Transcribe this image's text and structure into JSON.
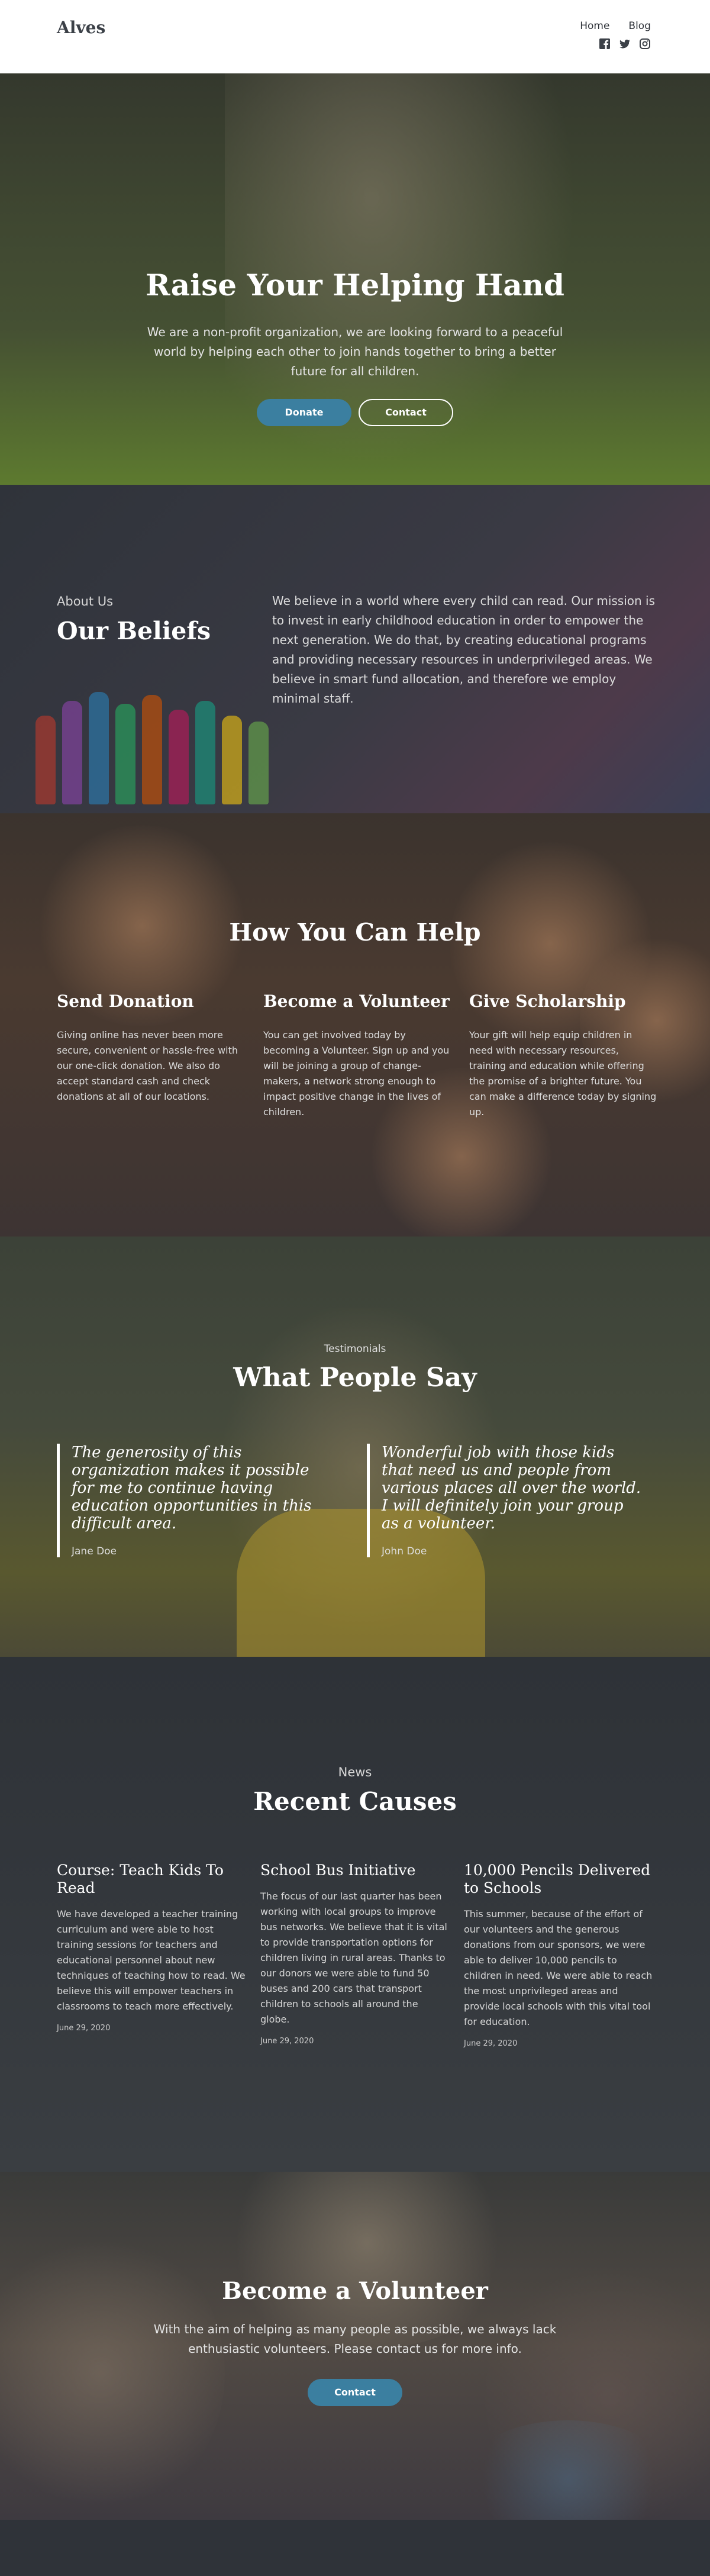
{
  "header": {
    "logo": "Alves",
    "nav": [
      {
        "label": "Home"
      },
      {
        "label": "Blog"
      }
    ],
    "social_icons": [
      "facebook-icon",
      "twitter-icon",
      "instagram-icon"
    ]
  },
  "hero": {
    "title": "Raise Your Helping Hand",
    "text": "We are a non-profit organization, we are looking forward to a peaceful world by helping each other to join hands together to bring a better future for all children.",
    "donate_label": "Donate",
    "contact_label": "Contact"
  },
  "about": {
    "label": "About Us",
    "title": "Our Beliefs",
    "text": "We believe in a world where every child can read. Our mission is to invest in early childhood education in order to empower the next generation. We do that, by creating educational programs and providing necessary resources in underprivileged areas. We believe in smart fund allocation, and therefore we employ minimal staff."
  },
  "help": {
    "title": "How You Can Help",
    "items": [
      {
        "title": "Send Donation",
        "text": "Giving online has never been more secure, convenient or hassle-free with our one-click donation. We also do accept standard cash and check donations at all of our locations."
      },
      {
        "title": "Become a Volunteer",
        "text": "You can get involved today by becoming a Volunteer. Sign up and you will be joining a group of change-makers, a network strong enough to impact positive change in the lives of children."
      },
      {
        "title": "Give Scholarship",
        "text": "Your gift will help equip children in need with necessary resources, training and education while offering the promise of a brighter future. You can make a difference today by signing up."
      }
    ]
  },
  "testimonials": {
    "label": "Testimonials",
    "title": "What People Say",
    "items": [
      {
        "quote": "The generosity of this organization makes it possible for me to continue having education opportunities in this difficult area.",
        "author": "Jane Doe"
      },
      {
        "quote": "Wonderful job with those kids that need us and people from various places all over the world. I will definitely join your group as a volunteer.",
        "author": "John Doe"
      }
    ]
  },
  "causes": {
    "label": "News",
    "title": "Recent Causes",
    "items": [
      {
        "title": "Course: Teach Kids To Read",
        "text": "We have developed a teacher training curriculum and were able to host training sessions for teachers and educational personnel about new techniques of teaching how to read. We believe this will empower teachers in classrooms to teach more effectively.",
        "date": "June 29, 2020"
      },
      {
        "title": "School Bus Initiative",
        "text": "The focus of our last quarter has been working with local groups to improve bus networks. We believe that it is vital to provide transportation options for children living in rural areas. Thanks to our donors we were able to fund 50 buses and 200 cars that transport children to schools all around the globe.",
        "date": "June 29, 2020"
      },
      {
        "title": "10,000 Pencils Delivered to Schools",
        "text": "This summer, because of the effort of our volunteers and the generous donations from our sponsors, we were able to deliver 10,000 pencils to children in need. We were able to reach the most unprivileged areas and provide local schools with this vital tool for education.",
        "date": "June 29, 2020"
      }
    ]
  },
  "volunteer": {
    "title": "Become a Volunteer",
    "text": "With the aim of helping as many people as possible, we always lack enthusiastic volunteers. Please contact us for more info.",
    "contact_label": "Contact"
  },
  "colors": {
    "accent": "#3b7fa0",
    "header_bg": "#ffffff",
    "footer_bg": "#2f3339"
  }
}
